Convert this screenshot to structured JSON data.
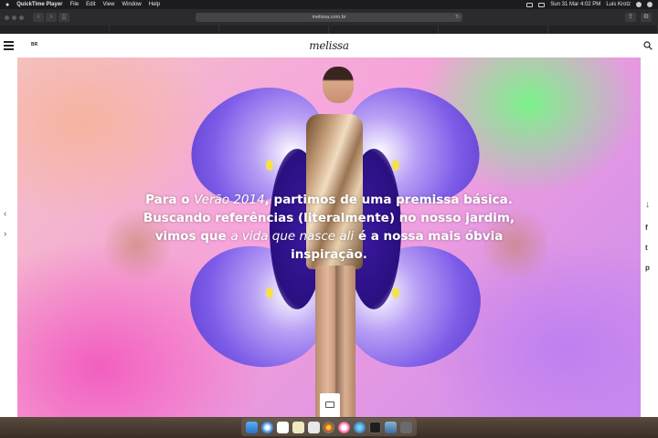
{
  "menubar": {
    "app_name": "QuickTime Player",
    "items": [
      "File",
      "Edit",
      "View",
      "Window",
      "Help"
    ],
    "clock": "Sun 31 Mar  4:02 PM",
    "user": "Luis Krotz"
  },
  "browser": {
    "url": "melissa.com.br"
  },
  "site": {
    "lang": "BR",
    "logo": "melissa"
  },
  "hero": {
    "text_a": "Para o ",
    "text_b": "Verão 2014",
    "text_c": ", partimos de uma premissa básica. Buscando referências (literalmente) no nosso jardim, vimos que ",
    "text_d": "a vida que nasce ali",
    "text_e": " é a nossa mais óbvia inspiração."
  },
  "side": {
    "prev": "‹",
    "next": "›",
    "scroll_down": "↓",
    "facebook": "f",
    "twitter": "t",
    "pinterest": "p"
  },
  "colors": {
    "accent": "#7d5ce8",
    "header_bg": "#ffffff"
  }
}
